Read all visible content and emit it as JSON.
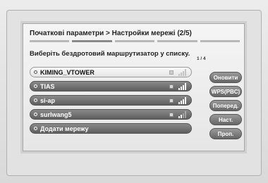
{
  "dialog": {
    "title": "Початкові параметри > Настройки мережі (2/5)",
    "progress": {
      "step": 2,
      "total": 5
    },
    "instruction": "Виберіть бездротовий маршрутизатор у списку.",
    "page_indicator": "1 / 4"
  },
  "networks": [
    {
      "name": "KIMING_VTOWER",
      "selected": true,
      "locked": true,
      "signal_bars": 4
    },
    {
      "name": "TIAS",
      "selected": false,
      "locked": true,
      "signal_bars": 4
    },
    {
      "name": "si-ap",
      "selected": false,
      "locked": true,
      "signal_bars": 4
    },
    {
      "name": "surlwang5",
      "selected": false,
      "locked": true,
      "signal_bars": 2
    },
    {
      "name": "Додати мережу",
      "selected": false,
      "locked": false,
      "signal_bars": 0
    }
  ],
  "buttons": {
    "refresh": "Оновити",
    "wps": "WPS(PBC)",
    "previous": "Поперед.",
    "next": "Наст.",
    "skip": "Проп."
  },
  "colors": {
    "item_bg": "#6e6e6e",
    "item_selected_bg": "#f2f2f2",
    "dialog_bg": "#efefef"
  }
}
